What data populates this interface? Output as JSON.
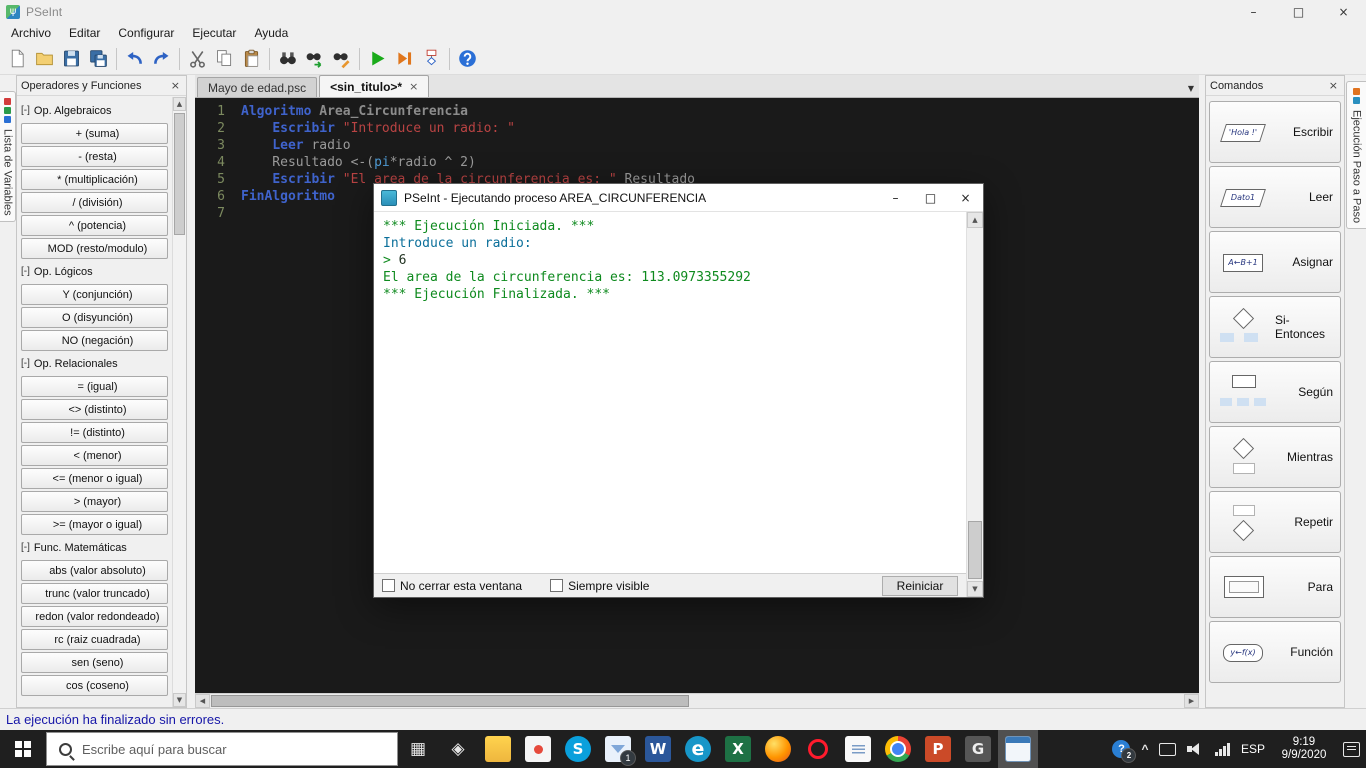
{
  "window": {
    "title": "PSeInt",
    "icon_glyph": "ψ",
    "controls": {
      "minimize": "–",
      "maximize": "□",
      "close": "×"
    }
  },
  "glyphs": {
    "up": "▲",
    "down": "▼",
    "left": "◀",
    "right": "▶",
    "dropdown": "▼",
    "close": "×",
    "chevron_up": "^"
  },
  "menu": {
    "items": [
      "Archivo",
      "Editar",
      "Configurar",
      "Ejecutar",
      "Ayuda"
    ]
  },
  "toolbar": {
    "icons": [
      "new-file",
      "open-file",
      "save-file",
      "save-all",
      "undo",
      "redo",
      "cut",
      "copy",
      "paste",
      "find",
      "find-next",
      "replace",
      "run",
      "step-run",
      "flowchart",
      "help"
    ]
  },
  "left_strip": {
    "tab_label": "Lista de Variables"
  },
  "left_panel": {
    "title": "Operadores y Funciones",
    "entries": [
      {
        "type": "header",
        "prefix": "[-]",
        "label": "Op. Algebraicos"
      },
      {
        "type": "item",
        "label": "+ (suma)"
      },
      {
        "type": "item",
        "label": "- (resta)"
      },
      {
        "type": "item",
        "label": "* (multiplicación)"
      },
      {
        "type": "item",
        "label": "/ (división)"
      },
      {
        "type": "item",
        "label": "^ (potencia)"
      },
      {
        "type": "item",
        "label": "MOD (resto/modulo)"
      },
      {
        "type": "header",
        "prefix": "[-]",
        "label": "Op. Lógicos"
      },
      {
        "type": "item",
        "label": "Y (conjunción)"
      },
      {
        "type": "item",
        "label": "O (disyunción)"
      },
      {
        "type": "item",
        "label": "NO (negación)"
      },
      {
        "type": "header",
        "prefix": "[-]",
        "label": "Op. Relacionales"
      },
      {
        "type": "item",
        "label": "= (igual)"
      },
      {
        "type": "item",
        "label": "<> (distinto)"
      },
      {
        "type": "item",
        "label": "!= (distinto)"
      },
      {
        "type": "item",
        "label": "< (menor)"
      },
      {
        "type": "item",
        "label": "<= (menor o igual)"
      },
      {
        "type": "item",
        "label": "> (mayor)"
      },
      {
        "type": "item",
        "label": ">= (mayor o igual)"
      },
      {
        "type": "header",
        "prefix": "[-]",
        "label": "Func. Matemáticas"
      },
      {
        "type": "item",
        "label": "abs (valor absoluto)"
      },
      {
        "type": "item",
        "label": "trunc (valor truncado)"
      },
      {
        "type": "item",
        "label": "redon (valor redondeado)"
      },
      {
        "type": "item",
        "label": "rc (raiz cuadrada)"
      },
      {
        "type": "item",
        "label": "sen (seno)"
      },
      {
        "type": "item",
        "label": "cos (coseno)"
      }
    ]
  },
  "tabs": {
    "dropdown_glyph": "▼",
    "items": [
      {
        "label": "Mayo de edad.psc",
        "active": false
      },
      {
        "label": "<sin_titulo>*",
        "active": true,
        "close_glyph": "×"
      }
    ]
  },
  "editor": {
    "lines": [
      {
        "num": "1",
        "segments": [
          {
            "text": "Algoritmo ",
            "style": "kw"
          },
          {
            "text": "Area_Circunferencia",
            "style": "id"
          }
        ]
      },
      {
        "num": "2",
        "segments": [
          {
            "text": "    ",
            "style": "pl"
          },
          {
            "text": "Escribir ",
            "style": "kw"
          },
          {
            "text": "\"Introduce un radio: \"",
            "style": "str"
          }
        ]
      },
      {
        "num": "3",
        "segments": [
          {
            "text": "    ",
            "style": "pl"
          },
          {
            "text": "Leer ",
            "style": "kw"
          },
          {
            "text": "radio",
            "style": "pl"
          }
        ]
      },
      {
        "num": "4",
        "segments": [
          {
            "text": "    Resultado <-(",
            "style": "pl"
          },
          {
            "text": "pi",
            "style": "fn"
          },
          {
            "text": "*radio ^ 2)",
            "style": "pl"
          }
        ]
      },
      {
        "num": "5",
        "segments": [
          {
            "text": "    ",
            "style": "pl"
          },
          {
            "text": "Escribir ",
            "style": "kw"
          },
          {
            "text": "\"El area de la circunferencia es: \"",
            "style": "str"
          },
          {
            "text": " Resultado",
            "style": "pl"
          }
        ]
      },
      {
        "num": "6",
        "segments": [
          {
            "text": "FinAlgoritmo",
            "style": "kw"
          }
        ]
      },
      {
        "num": "7",
        "segments": []
      }
    ]
  },
  "exec_window": {
    "title": "PSeInt - Ejecutando proceso AREA_CIRCUNFERENCIA",
    "controls": {
      "minimize": "–",
      "maximize": "□",
      "close": "×"
    },
    "console": [
      {
        "segments": [
          {
            "text": "*** Ejecución Iniciada. ***",
            "color": "#0e8a1e"
          }
        ]
      },
      {
        "segments": [
          {
            "text": "Introduce un radio:",
            "color": "#0b6f9a"
          }
        ]
      },
      {
        "segments": [
          {
            "text": "> ",
            "color": "#0e8a1e"
          },
          {
            "text": "6",
            "color": "#223322"
          }
        ]
      },
      {
        "segments": [
          {
            "text": "El area de la circunferencia es: 113.0973355292",
            "color": "#0e8a1e"
          }
        ]
      },
      {
        "segments": [
          {
            "text": "*** Ejecución Finalizada. ***",
            "color": "#0e8a1e"
          }
        ]
      }
    ],
    "checkboxes": [
      {
        "label": "No cerrar esta ventana",
        "checked": false
      },
      {
        "label": "Siempre visible",
        "checked": false
      }
    ],
    "restart_label": "Reiniciar"
  },
  "right_panel": {
    "title": "Comandos",
    "commands": [
      {
        "label": "Escribir",
        "icon": "escribir",
        "caption": "'Hola !'"
      },
      {
        "label": "Leer",
        "icon": "leer",
        "caption": "Dato1"
      },
      {
        "label": "Asignar",
        "icon": "asignar",
        "caption": "A←B+1"
      },
      {
        "label": "Si-Entonces",
        "icon": "si-entonces",
        "caption": ""
      },
      {
        "label": "Según",
        "icon": "segun",
        "caption": ""
      },
      {
        "label": "Mientras",
        "icon": "mientras",
        "caption": ""
      },
      {
        "label": "Repetir",
        "icon": "repetir",
        "caption": ""
      },
      {
        "label": "Para",
        "icon": "para",
        "caption": ""
      },
      {
        "label": "Función",
        "icon": "funcion",
        "caption": "y←f(x)"
      }
    ]
  },
  "right_strip": {
    "tab_label": "Ejecución Paso a Paso"
  },
  "status_bar": {
    "message": "La ejecución ha finalizado sin errores."
  },
  "taskbar": {
    "search": {
      "placeholder": "Escribe aquí para buscar"
    },
    "apps": [
      {
        "name": "task-view-icon",
        "glyph": "▦",
        "fg": "#e6e6e6"
      },
      {
        "name": "chat-icon",
        "glyph": "◈",
        "fg": "#e6e6e6"
      },
      {
        "name": "file-explorer-icon",
        "glyph": ""
      },
      {
        "name": "store-icon",
        "glyph": ""
      },
      {
        "name": "skype-icon",
        "glyph": "S",
        "fg": "#ffffff",
        "bg": "#0aa0dc"
      },
      {
        "name": "mail-icon",
        "glyph": "",
        "badge": "1"
      },
      {
        "name": "word-icon",
        "glyph": "W",
        "fg": "#ffffff",
        "bg": "#2b579a"
      },
      {
        "name": "edge-icon",
        "glyph": "e",
        "fg": "#ffffff",
        "bg": "#1796c8"
      },
      {
        "name": "excel-icon",
        "glyph": "X",
        "fg": "#ffffff",
        "bg": "#1e7145"
      },
      {
        "name": "firefox-icon",
        "glyph": ""
      },
      {
        "name": "opera-icon",
        "glyph": ""
      },
      {
        "name": "document-icon",
        "glyph": ""
      },
      {
        "name": "chrome-icon",
        "glyph": ""
      },
      {
        "name": "powerpoint-icon",
        "glyph": "P",
        "fg": "#ffffff",
        "bg": "#cb4a28"
      },
      {
        "name": "gimp-icon",
        "glyph": "G",
        "fg": "#eeeeee",
        "bg": "#565656"
      },
      {
        "name": "pseint-taskbar-icon",
        "glyph": "",
        "active": true
      }
    ],
    "tray": {
      "help_glyph": "?",
      "help_badge": "2",
      "chevron": "^",
      "language": "ESP",
      "time": "9:19",
      "date": "9/9/2020"
    }
  },
  "colors": {
    "keyword": "#3f63cc",
    "identifier": "#8c8c8c",
    "plain": "#9a9a9a",
    "string": "#b94343",
    "function": "#4f9bd4",
    "editor_bg": "#1a1a1a",
    "status_text": "#1616a8",
    "console_green": "#0e8a1e",
    "console_teal": "#0b6f9a",
    "run_button": "#1aab1a"
  }
}
